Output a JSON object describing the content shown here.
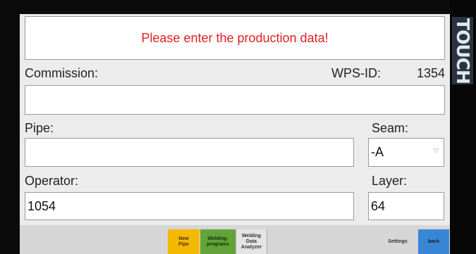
{
  "brand": "TOUCH",
  "message": "Please enter the production data!",
  "commission": {
    "label": "Commission:",
    "value": ""
  },
  "wps": {
    "label": "WPS-ID:",
    "value": "1354"
  },
  "pipe": {
    "label": "Pipe:",
    "value": ""
  },
  "seam": {
    "label": "Seam:",
    "value": "-A"
  },
  "operator": {
    "label": "Operator:",
    "value": "1054"
  },
  "layer": {
    "label": "Layer:",
    "value": "64"
  },
  "footer": {
    "new_pipe": [
      "New",
      "Pipe"
    ],
    "welding_programs": [
      "Welding-",
      "programs"
    ],
    "welding_data_analyzer": [
      "Welding",
      "Data",
      "Analyzer"
    ],
    "settings": "Settings",
    "back": "back"
  },
  "colors": {
    "message": "#e02020",
    "new_pipe_bg": "#f5b800",
    "welding_programs_bg": "#62a43a",
    "back_bg": "#3a86d6"
  }
}
